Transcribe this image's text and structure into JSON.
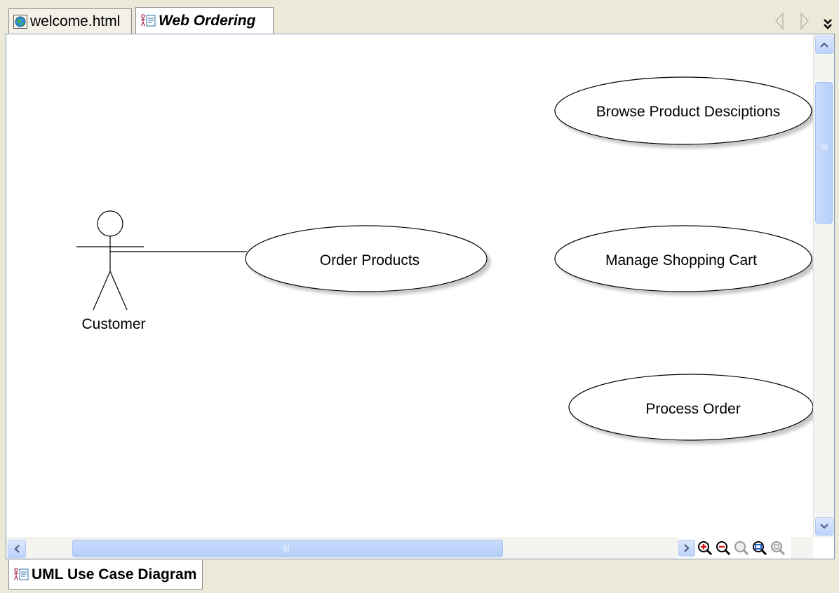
{
  "tabs": [
    {
      "label": "welcome.html",
      "icon": "globe-icon",
      "active": false
    },
    {
      "label": "Web Ordering",
      "icon": "use-case-diagram-icon",
      "active": true
    }
  ],
  "tab_nav": {
    "prev_icon": "scroll-tabs-left-icon",
    "next_icon": "scroll-tabs-right-icon",
    "menu_icon": "tab-list-menu-icon"
  },
  "diagram": {
    "actor": {
      "name": "Customer"
    },
    "use_cases": [
      {
        "name": "Browse Product Desciptions"
      },
      {
        "name": "Order Products"
      },
      {
        "name": "Manage Shopping Cart"
      },
      {
        "name": "Process Order"
      }
    ],
    "associations": [
      {
        "from": "Customer",
        "to": "Order Products"
      }
    ]
  },
  "zoom_controls": [
    "zoom-in-icon",
    "zoom-out-icon",
    "zoom-reset-icon",
    "zoom-to-fit-icon",
    "zoom-select-icon"
  ],
  "bottom_tab": {
    "label": "UML Use Case Diagram",
    "icon": "use-case-diagram-icon"
  },
  "colors": {
    "scroll_accent": "#c1d5fb",
    "frame": "#ece9d8"
  }
}
